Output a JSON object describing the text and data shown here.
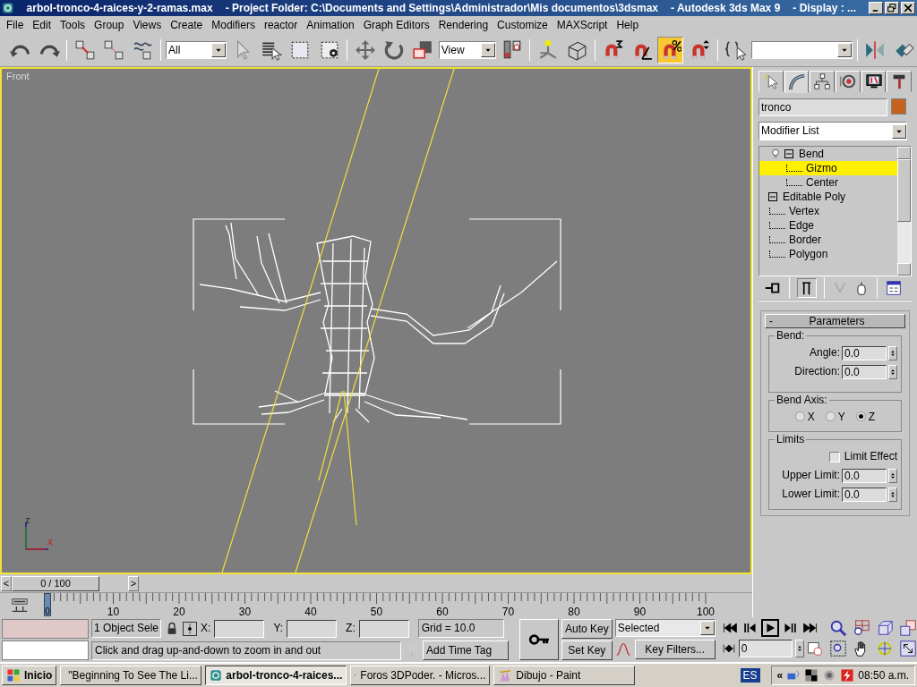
{
  "title_bar": {
    "segments": [
      "arbol-tronco-4-raices-y-2-ramas.max",
      "- Project Folder: C:\\Documents and Settings\\Administrador\\Mis documentos\\3dsmax",
      "- Autodesk 3ds Max 9",
      "- Display : ..."
    ]
  },
  "menu": [
    "File",
    "Edit",
    "Tools",
    "Group",
    "Views",
    "Create",
    "Modifiers",
    "reactor",
    "Animation",
    "Graph Editors",
    "Rendering",
    "Customize",
    "MAXScript",
    "Help"
  ],
  "toolbar": {
    "selection_filter": "All",
    "reference_coord": "View",
    "percent_snap_on": true
  },
  "viewport": {
    "label": "Front",
    "axis_labels": [
      "z",
      "x"
    ]
  },
  "command_panel": {
    "tabs": [
      {
        "selected": false
      },
      {
        "selected": true
      },
      {
        "selected": false
      },
      {
        "selected": false
      },
      {
        "selected": false
      },
      {
        "selected": false
      }
    ],
    "object_name": "tronco",
    "modifier_list": "Modifier List",
    "stack": [
      {
        "label": "Bend",
        "expanded": true,
        "children": [
          {
            "label": "Gizmo",
            "selected": true
          },
          {
            "label": "Center",
            "selected": false
          }
        ]
      },
      {
        "label": "Editable Poly",
        "expanded": true,
        "children": [
          {
            "label": "Vertex",
            "selected": false
          },
          {
            "label": "Edge",
            "selected": false
          },
          {
            "label": "Border",
            "selected": false
          },
          {
            "label": "Polygon",
            "selected": false
          }
        ]
      }
    ],
    "rollout": {
      "collapse_sign": "-",
      "title": "Parameters",
      "groups": [
        {
          "kind": "spinners",
          "title": "Bend:",
          "fields": [
            {
              "label": "Angle:",
              "value": "0.0"
            },
            {
              "label": "Direction:",
              "value": "0.0"
            }
          ]
        },
        {
          "kind": "radios",
          "title": "Bend Axis:",
          "options": [
            {
              "label": "X",
              "selected": false
            },
            {
              "label": "Y",
              "selected": false
            },
            {
              "label": "Z",
              "selected": true
            }
          ]
        },
        {
          "kind": "limits",
          "title": "Limits",
          "checkbox": {
            "label": "Limit Effect",
            "checked": false
          },
          "fields": [
            {
              "label": "Upper Limit:",
              "value": "0.0"
            },
            {
              "label": "Lower Limit:",
              "value": "0.0"
            }
          ]
        }
      ]
    }
  },
  "time_slider": {
    "prev": "<",
    "label": "0 / 100",
    "next": ">",
    "level": 0
  },
  "track_bar": {
    "current_frame": "0",
    "labels": [
      "10",
      "20",
      "30",
      "40",
      "50",
      "60",
      "70",
      "80",
      "90",
      "100"
    ]
  },
  "status": {
    "selection": "1 Object Sele",
    "x_label": "X:",
    "y_label": "Y:",
    "z_label": "Z:",
    "grid": "Grid = 10.0",
    "prompt": "Click and drag up-and-down to zoom in and out",
    "time_tag": "Add Time Tag"
  },
  "animation": {
    "auto_key": "Auto Key",
    "set_key": "Set Key",
    "key_mode": "Selected",
    "key_filters": "Key Filters...",
    "frame": "0"
  },
  "taskbar": {
    "start": "Inicio",
    "tasks": [
      {
        "label": "\"Beginning To See The Li...",
        "selected": false
      },
      {
        "label": "arbol-tronco-4-raices...",
        "selected": true
      },
      {
        "label": "Foros 3DPoder. - Micros...",
        "selected": false
      },
      {
        "label": "Dibujo - Paint",
        "selected": false
      }
    ],
    "language": "ES",
    "tray_expand": "«",
    "clock": "08:50 a.m."
  }
}
